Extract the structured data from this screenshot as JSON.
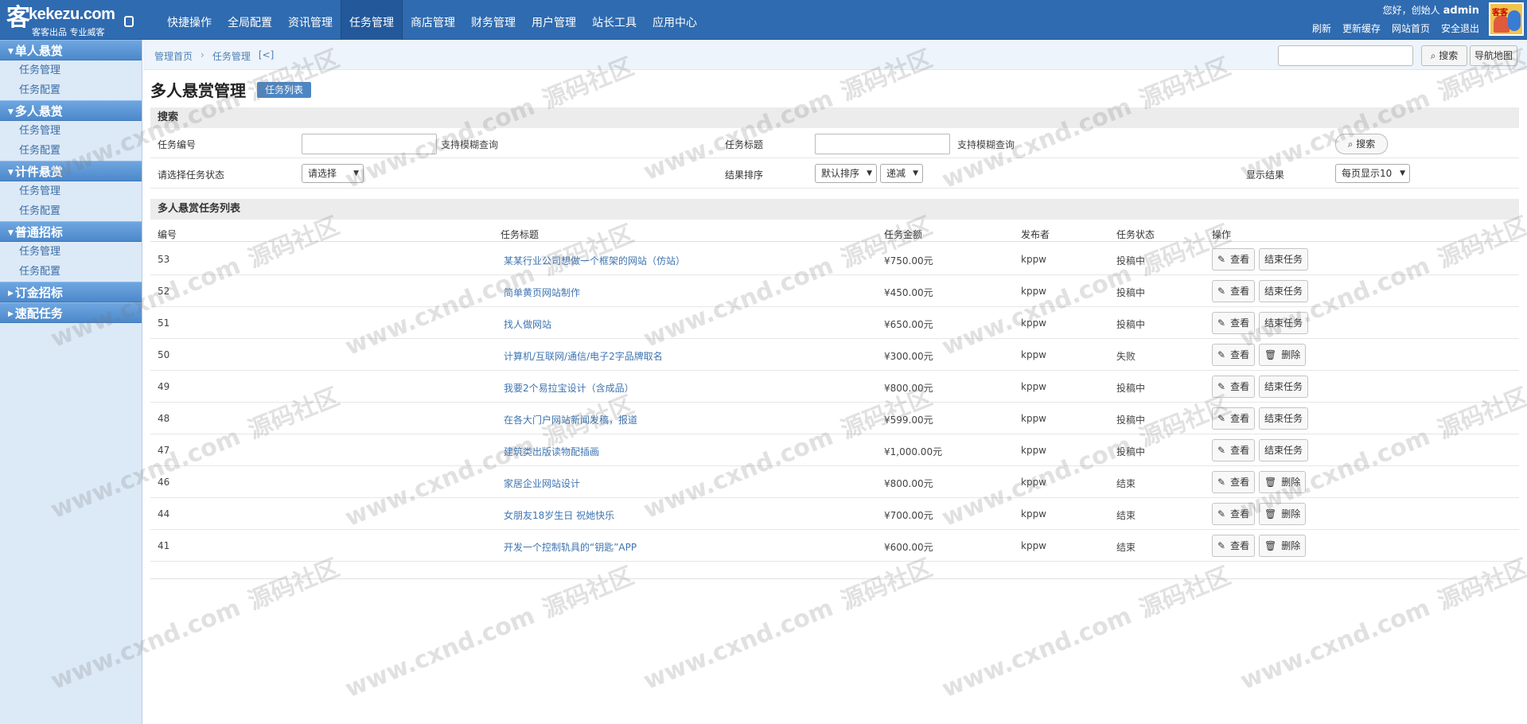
{
  "header": {
    "brand": "kekezu.com",
    "slogan": "客客出品 专业威客",
    "nav": [
      "快捷操作",
      "全局配置",
      "资讯管理",
      "任务管理",
      "商店管理",
      "财务管理",
      "用户管理",
      "站长工具",
      "应用中心"
    ],
    "active_nav": "任务管理",
    "greeting": "您好，创始人",
    "username": "admin",
    "links": [
      "刷新",
      "更新缓存",
      "网站首页",
      "安全退出"
    ]
  },
  "sidebar": {
    "groups": [
      {
        "title": "单人悬赏",
        "items": [
          "任务管理",
          "任务配置"
        ],
        "open": true
      },
      {
        "title": "多人悬赏",
        "items": [
          "任务管理",
          "任务配置"
        ],
        "open": true
      },
      {
        "title": "计件悬赏",
        "items": [
          "任务管理",
          "任务配置"
        ],
        "open": true
      },
      {
        "title": "普通招标",
        "items": [
          "任务管理",
          "任务配置"
        ],
        "open": true
      },
      {
        "title": "订金招标",
        "items": [],
        "open": false
      },
      {
        "title": "速配任务",
        "items": [],
        "open": false
      }
    ]
  },
  "breadcrumb": [
    "管理首页",
    "任务管理",
    "[<]"
  ],
  "topbar": {
    "search_label": "搜索",
    "sitemap_label": "导航地图"
  },
  "page": {
    "title": "多人悬赏管理",
    "tab": "任务列表"
  },
  "search": {
    "heading": "搜索",
    "task_id_label": "任务编号",
    "fuzzy_hint": "支持模糊查询",
    "task_title_label": "任务标题",
    "status_label": "请选择任务状态",
    "status_value": "请选择",
    "sort_label": "结果排序",
    "sort_value": "默认排序",
    "order_value": "递减",
    "display_label": "显示结果",
    "display_value": "每页显示10",
    "button": "搜索"
  },
  "table": {
    "heading": "多人悬赏任务列表",
    "columns": [
      "编号",
      "任务标题",
      "任务金额",
      "发布者",
      "任务状态",
      "操作"
    ],
    "view_label": "查看",
    "end_label": "结束任务",
    "delete_label": "删除",
    "rows": [
      {
        "id": "53",
        "title": "某某行业公司想做一个框架的网站（仿站）",
        "amount": "¥750.00元",
        "publisher": "kppw",
        "status": "投稿中",
        "action": "end"
      },
      {
        "id": "52",
        "title": "简单黄页网站制作",
        "amount": "¥450.00元",
        "publisher": "kppw",
        "status": "投稿中",
        "action": "end"
      },
      {
        "id": "51",
        "title": "找人做网站",
        "amount": "¥650.00元",
        "publisher": "kppw",
        "status": "投稿中",
        "action": "end"
      },
      {
        "id": "50",
        "title": "计算机/互联网/通信/电子2字品牌取名",
        "amount": "¥300.00元",
        "publisher": "kppw",
        "status": "失败",
        "action": "delete"
      },
      {
        "id": "49",
        "title": "我要2个易拉宝设计（含成品）",
        "amount": "¥800.00元",
        "publisher": "kppw",
        "status": "投稿中",
        "action": "end"
      },
      {
        "id": "48",
        "title": "在各大门户网站新闻发稿，报道",
        "amount": "¥599.00元",
        "publisher": "kppw",
        "status": "投稿中",
        "action": "end"
      },
      {
        "id": "47",
        "title": "建筑类出版读物配插画",
        "amount": "¥1,000.00元",
        "publisher": "kppw",
        "status": "投稿中",
        "action": "end"
      },
      {
        "id": "46",
        "title": "家居企业网站设计",
        "amount": "¥800.00元",
        "publisher": "kppw",
        "status": "结束",
        "action": "delete"
      },
      {
        "id": "44",
        "title": "女朋友18岁生日 祝她快乐",
        "amount": "¥700.00元",
        "publisher": "kppw",
        "status": "结束",
        "action": "delete"
      },
      {
        "id": "41",
        "title": "开发一个控制轨具的“钥匙”APP",
        "amount": "¥600.00元",
        "publisher": "kppw",
        "status": "结束",
        "action": "delete"
      }
    ]
  },
  "watermark": {
    "text1": "www.cxnd.com",
    "text2": "源码社区"
  }
}
